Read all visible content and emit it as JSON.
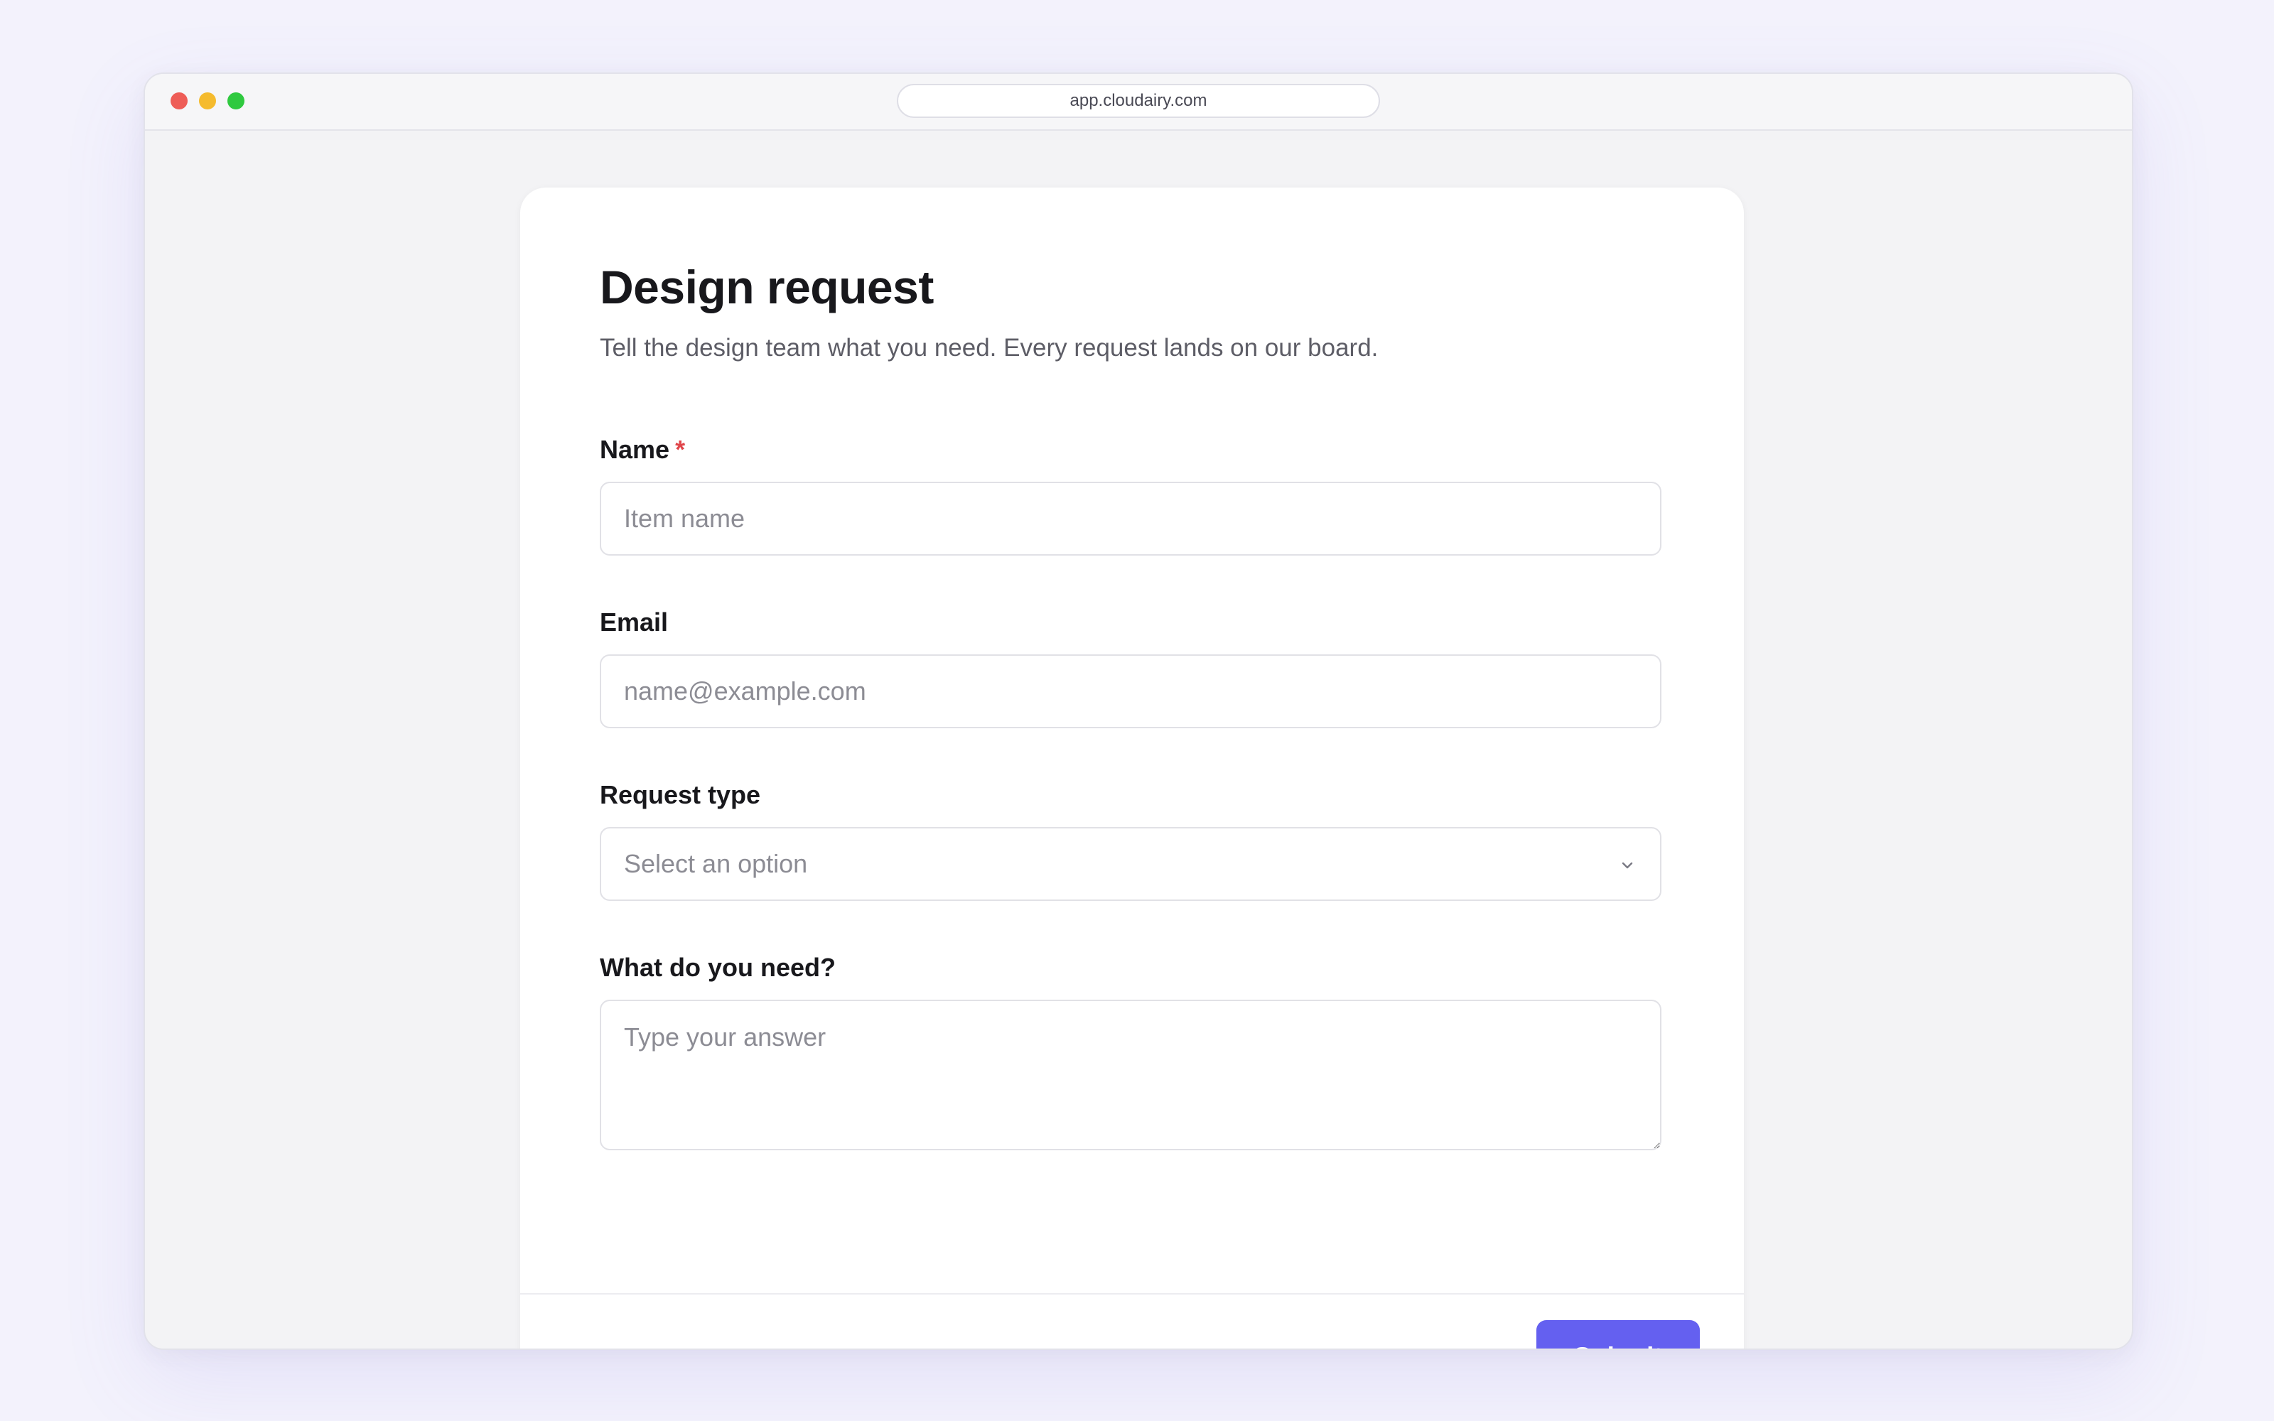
{
  "browser": {
    "url": "app.cloudairy.com"
  },
  "form": {
    "title": "Design request",
    "subtitle": "Tell the design team what you need. Every request lands on our board.",
    "fields": {
      "name": {
        "label": "Name",
        "required_marker": "*",
        "placeholder": "Item name",
        "value": ""
      },
      "email": {
        "label": "Email",
        "placeholder": "name@example.com",
        "value": ""
      },
      "request_type": {
        "label": "Request type",
        "placeholder": "Select an option",
        "icon": "chevron-down-icon"
      },
      "need": {
        "label": "What do you need?",
        "placeholder": "Type your answer",
        "value": ""
      }
    },
    "submit_label": "Submit"
  },
  "colors": {
    "accent": "#6460f0",
    "required": "#e0454a",
    "page_background": "#f3f2fc"
  }
}
